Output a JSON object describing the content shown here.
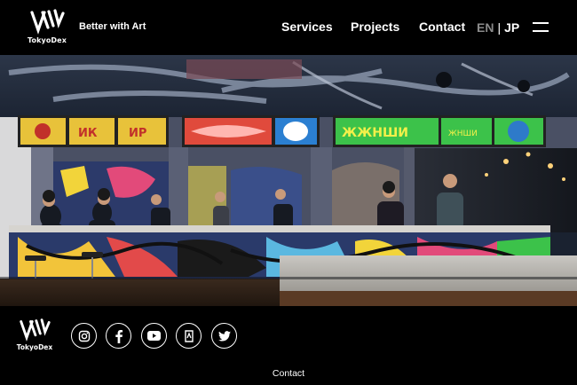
{
  "brand": {
    "name": "TokyoDex",
    "tagline": "Better with Art"
  },
  "nav": {
    "services": "Services",
    "projects": "Projects",
    "contact": "Contact"
  },
  "lang": {
    "en": "EN",
    "separator": "|",
    "jp": "JP"
  },
  "icons": {
    "menu": "hamburger-menu-icon",
    "social": [
      "instagram-icon",
      "facebook-icon",
      "youtube-icon",
      "note-icon",
      "twitter-icon"
    ]
  },
  "hero": {
    "description": "photo of restaurant interior with graffiti art counters and neon signs"
  },
  "footer": {
    "contact": "Contact"
  },
  "colors": {
    "background": "#000000",
    "text": "#ffffff",
    "inactive_lang": "#8a8a8a"
  }
}
